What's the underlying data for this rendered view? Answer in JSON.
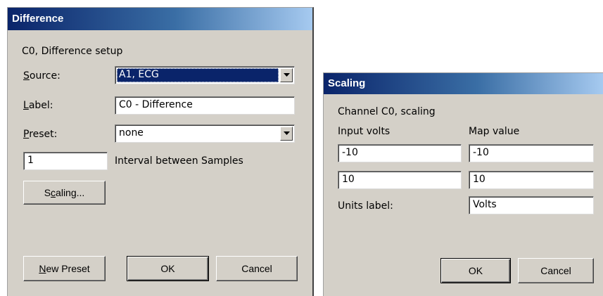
{
  "difference_dialog": {
    "title": "Difference",
    "subtitle": "C0, Difference setup",
    "source": {
      "label_first": "S",
      "label_rest": "ource:",
      "value": "A1, ECG"
    },
    "label_field": {
      "label_first": "L",
      "label_rest": "abel:",
      "value": "C0 - Difference"
    },
    "preset": {
      "label_first": "P",
      "label_rest": "reset:",
      "value": "none"
    },
    "interval": {
      "value": "1",
      "label": "Interval between Samples"
    },
    "scaling_button": {
      "pre": "S",
      "underlined": "c",
      "post": "aling..."
    },
    "new_preset_button": {
      "underlined": "N",
      "rest": "ew Preset"
    },
    "ok_button": "OK",
    "cancel_button": "Cancel"
  },
  "scaling_dialog": {
    "title": "Scaling",
    "subtitle": "Channel C0, scaling",
    "col_input": "Input volts",
    "col_map": "Map value",
    "rows": [
      {
        "input": "-10",
        "map": "-10"
      },
      {
        "input": "10",
        "map": "10"
      }
    ],
    "units_label": "Units label:",
    "units_value": "Volts",
    "ok_button": "OK",
    "cancel_button": "Cancel"
  },
  "colors": {
    "selection": "#0a246a",
    "dialog_bg": "#d4d0c8"
  }
}
